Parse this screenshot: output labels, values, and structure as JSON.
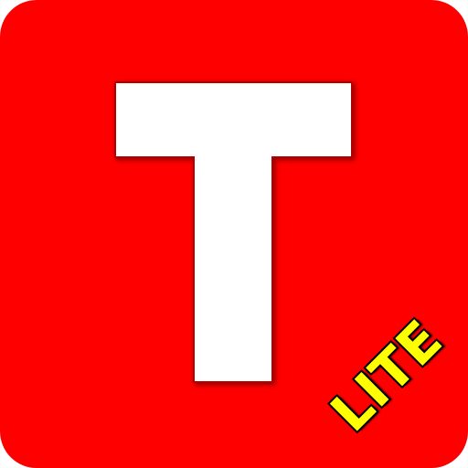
{
  "icon": {
    "letter": "T",
    "badge_text": "LITE",
    "background_color": "#ff0000",
    "letter_color": "#ffffff",
    "badge_color": "#ffff00"
  }
}
